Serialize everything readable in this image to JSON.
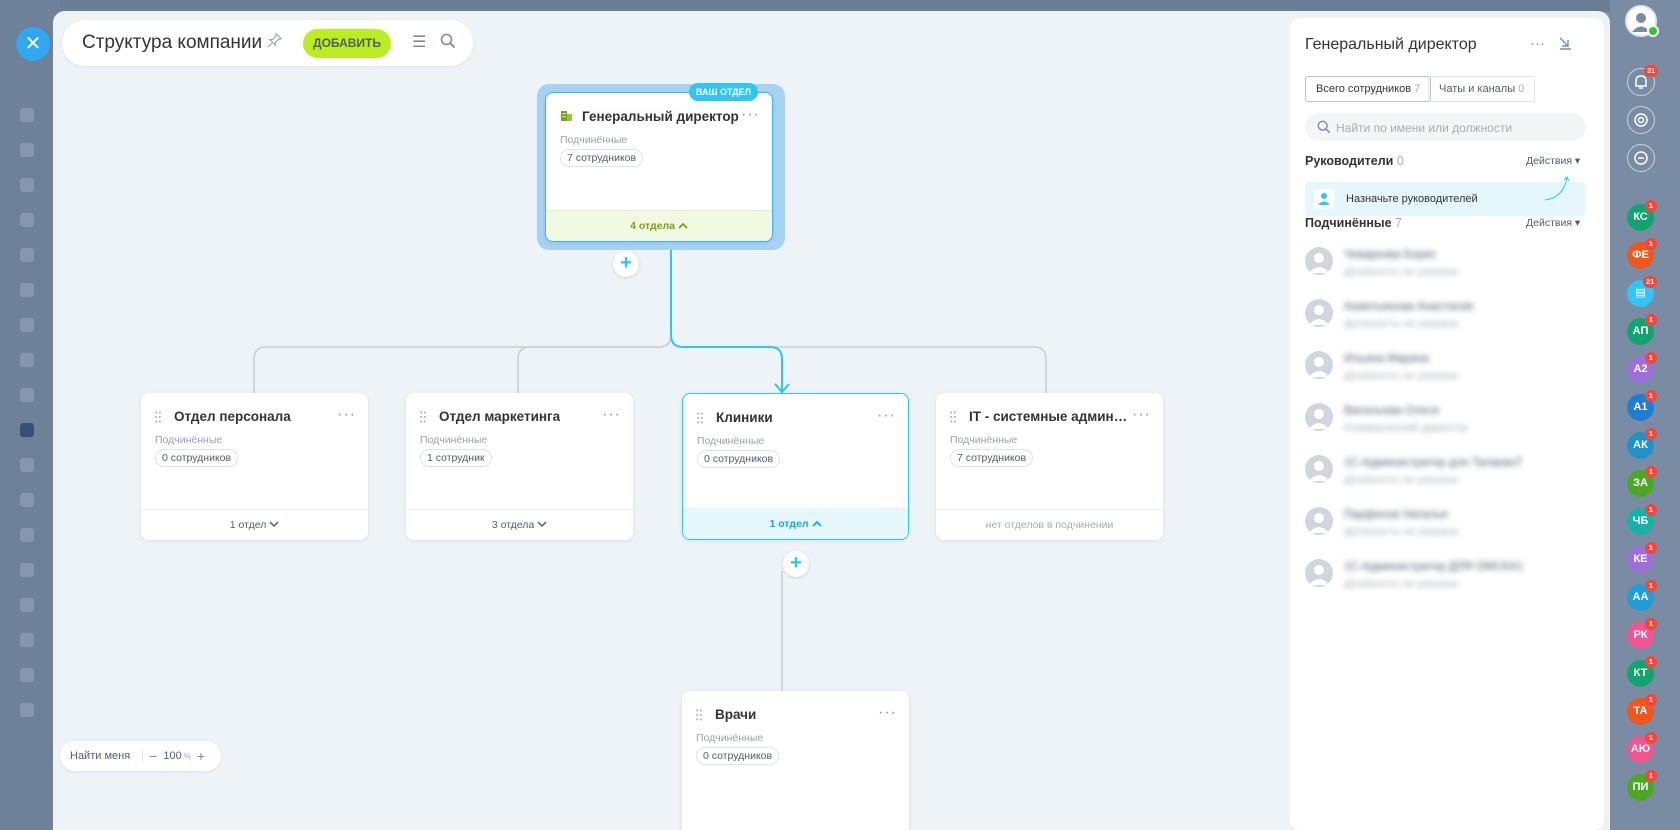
{
  "page": {
    "title": "Структура компании",
    "add_label": "Добавить"
  },
  "colors": {
    "accent": "#2fc6f6",
    "add_button": "#bbed21",
    "root_highlight": "#a6d2f4",
    "root_footer": "#f2f9e1"
  },
  "root": {
    "badge": "ВАШ ОТДЕЛ",
    "name": "Генеральный директор",
    "sub_label": "Подчинённые",
    "count": "7 сотрудников",
    "footer": "4 отдела"
  },
  "departments": [
    {
      "name": "Отдел персонала",
      "sub_label": "Подчинённые",
      "count": "0 сотрудников",
      "footer": "1 отдел"
    },
    {
      "name": "Отдел маркетинга",
      "sub_label": "Подчинённые",
      "count": "1 сотрудник",
      "footer": "3 отдела"
    },
    {
      "name": "Клиники",
      "sub_label": "Подчинённые",
      "count": "0 сотрудников",
      "footer": "1 отдел"
    },
    {
      "name": "IT - системные администрато...",
      "sub_label": "Подчинённые",
      "count": "7 сотрудников",
      "footer": "нет отделов в подчинении"
    }
  ],
  "child": {
    "name": "Врачи",
    "sub_label": "Подчинённые",
    "count": "0 сотрудников"
  },
  "zoom": {
    "find_me": "Найти меня",
    "value": "100",
    "unit": "%"
  },
  "panel": {
    "title": "Генеральный директор",
    "tabs": [
      {
        "label": "Всего сотрудников",
        "count": "7"
      },
      {
        "label": "Чаты и каналы",
        "count": "0"
      }
    ],
    "search_placeholder": "Найти по имени или должности",
    "heads_label": "Руководители",
    "heads_count": "0",
    "actions_label": "Действия",
    "assign_label": "Назначьте руководителей",
    "subordinates_label": "Подчинённые",
    "subordinates_count": "7",
    "employees": [
      {
        "name": "Чеваркова Борис",
        "position": "Должность не указана"
      },
      {
        "name": "Ахметьянова Анастасия",
        "position": "Должность не указана"
      },
      {
        "name": "Ильина Марина",
        "position": "Должность не указана"
      },
      {
        "name": "Васильева Олеся",
        "position": "Коммерческий директор"
      },
      {
        "name": "1С-Администратор для ТалаканТ",
        "position": "Должность не указана"
      },
      {
        "name": "Парфенов Наталья",
        "position": "Должность не указана"
      },
      {
        "name": "1С-Администратор ДЛЯ ОМСКА1",
        "position": "Должность не указана"
      }
    ]
  },
  "rail": {
    "notifications_count": "31",
    "chats": [
      {
        "initials": "КС",
        "count": "1",
        "color": "#12a46f"
      },
      {
        "initials": "ФЕ",
        "count": "1",
        "color": "#f2561d"
      },
      {
        "initials": "",
        "count": "21",
        "color": "#2fc6f6"
      },
      {
        "initials": "АП",
        "count": "1",
        "color": "#12a46f"
      },
      {
        "initials": "А2",
        "count": "1",
        "color": "#9e6fd9"
      },
      {
        "initials": "А1",
        "count": "1",
        "color": "#1f7dd6"
      },
      {
        "initials": "АК",
        "count": "1",
        "color": "#1f93c9"
      },
      {
        "initials": "ЗА",
        "count": "1",
        "color": "#4aa824"
      },
      {
        "initials": "ЧБ",
        "count": "1",
        "color": "#14b3a7"
      },
      {
        "initials": "КЕ",
        "count": "1",
        "color": "#9e6fd9"
      },
      {
        "initials": "АА",
        "count": "1",
        "color": "#1f9fd6"
      },
      {
        "initials": "РК",
        "count": "1",
        "color": "#f2558f"
      },
      {
        "initials": "КТ",
        "count": "1",
        "color": "#12a46f"
      },
      {
        "initials": "ТА",
        "count": "1",
        "color": "#f2561d"
      },
      {
        "initials": "АЮ",
        "count": "1",
        "color": "#f2558f"
      },
      {
        "initials": "ПИ",
        "count": "1",
        "color": "#4aa824"
      }
    ]
  }
}
